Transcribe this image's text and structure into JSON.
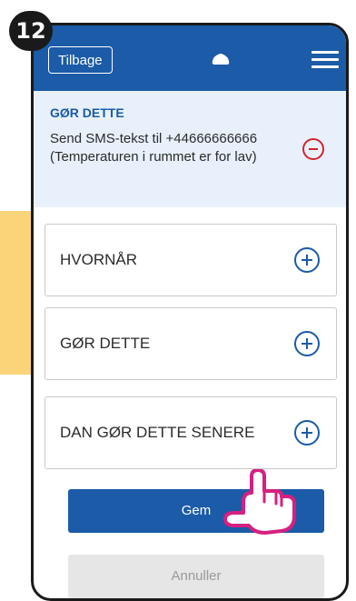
{
  "step": {
    "number": "12"
  },
  "colors": {
    "accent": "#1b5ba8",
    "remove": "#d7222b",
    "highlight_arrow": "#fbd47a",
    "pointer": "#d6207f"
  },
  "topbar": {
    "back_label": "Tilbage",
    "cloud_icon": "cloud-icon",
    "menu_icon": "hamburger-menu-icon"
  },
  "action": {
    "title": "GØR DETTE",
    "line1": "Send SMS-tekst til +44666666666",
    "line2": "(Temperaturen i rummet er for lav)",
    "remove_icon": "minus-circle-icon"
  },
  "cards": [
    {
      "label": "HVORNÅR",
      "icon": "plus-circle-icon"
    },
    {
      "label": "GØR DETTE",
      "icon": "plus-circle-icon"
    },
    {
      "label": "DAN GØR DETTE SENERE",
      "icon": "plus-circle-icon"
    }
  ],
  "buttons": {
    "save": "Gem",
    "cancel": "Annuller"
  },
  "pointer_icon": "tap-hand-icon"
}
